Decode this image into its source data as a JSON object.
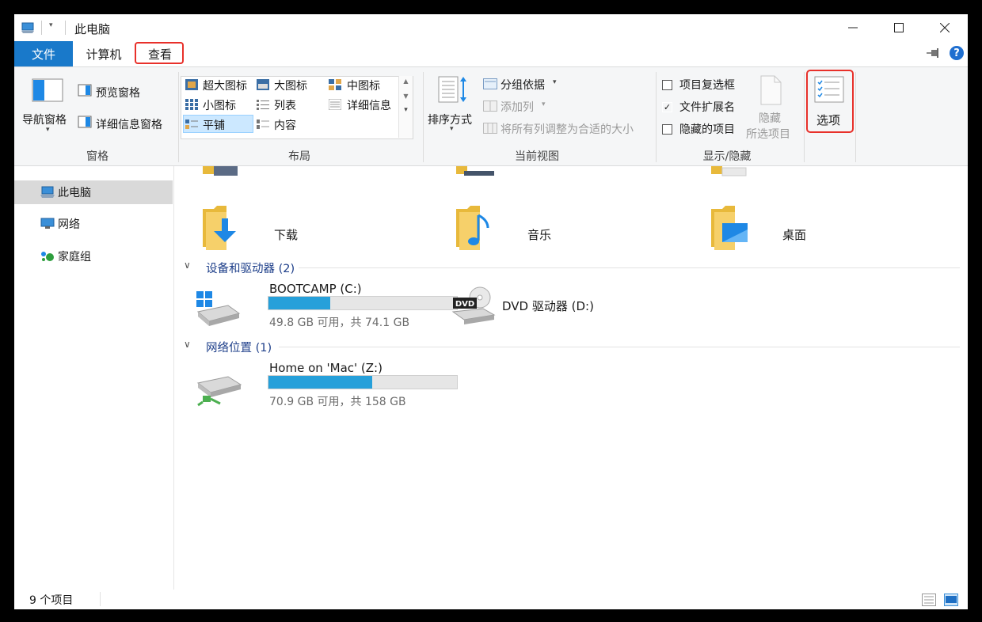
{
  "window": {
    "title": "此电脑"
  },
  "tabs": {
    "file": "文件",
    "computer": "计算机",
    "view": "查看"
  },
  "ribbon": {
    "panes": {
      "nav_pane": "导航窗格",
      "preview_pane": "预览窗格",
      "details_pane": "详细信息窗格",
      "label": "窗格"
    },
    "layout": {
      "extra_large": "超大图标",
      "large": "大图标",
      "medium": "中图标",
      "small": "小图标",
      "list": "列表",
      "details": "详细信息",
      "tiles": "平铺",
      "content": "内容",
      "label": "布局"
    },
    "current_view": {
      "sort_by": "排序方式",
      "group_by": "分组依据",
      "add_column": "添加列",
      "fit_columns": "将所有列调整为合适的大小",
      "label": "当前视图"
    },
    "show_hide": {
      "item_checkbox": "项目复选框",
      "file_ext": "文件扩展名",
      "hidden_items": "隐藏的项目",
      "hide_selected_line1": "隐藏",
      "hide_selected_line2": "所选项目",
      "label": "显示/隐藏",
      "item_checkbox_checked": false,
      "file_ext_checked": true,
      "hidden_items_checked": false
    },
    "options": {
      "label": "选项"
    }
  },
  "nav": {
    "items": [
      {
        "label": "此电脑",
        "selected": true
      },
      {
        "label": "网络",
        "selected": false
      },
      {
        "label": "家庭组",
        "selected": false
      }
    ]
  },
  "folders": [
    {
      "label": "下载"
    },
    {
      "label": "音乐"
    },
    {
      "label": "桌面"
    }
  ],
  "sections": {
    "devices": "设备和驱动器 (2)",
    "network": "网络位置 (1)"
  },
  "drives": [
    {
      "name": "BOOTCAMP (C:)",
      "info": "49.8 GB 可用，共 74.1 GB",
      "used_fraction": 0.328
    },
    {
      "name": "DVD 驱动器 (D:)"
    },
    {
      "name": "Home on 'Mac' (Z:)",
      "info": "70.9 GB 可用，共 158 GB",
      "used_fraction": 0.551
    }
  ],
  "status": {
    "count": "9 个项目"
  },
  "colors": {
    "accent": "#1979ca",
    "highlight": "#e8302a",
    "drive_fill": "#26a0da",
    "section_title": "#1e3f8a"
  }
}
